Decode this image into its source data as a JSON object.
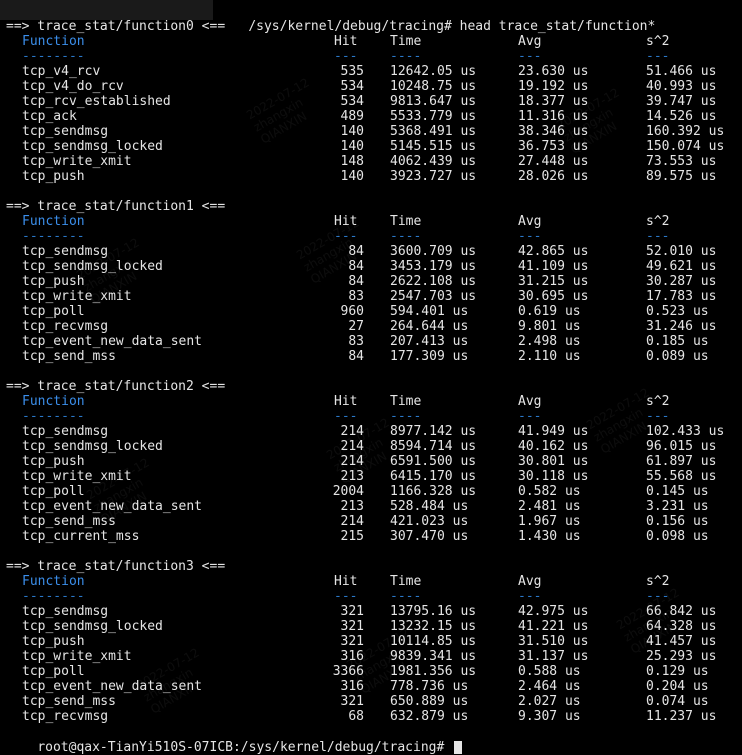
{
  "command": {
    "path_and_cmd": "/sys/kernel/debug/tracing# head trace_stat/function*"
  },
  "columns": {
    "function": "Function",
    "hit": "Hit",
    "time": "Time",
    "avg": "Avg",
    "s2": "s^2",
    "sep_function": "--------",
    "sep_short": "---",
    "sep_time": "----"
  },
  "sections": [
    {
      "header": "==> trace_stat/function0 <==",
      "rows": [
        {
          "name": "tcp_v4_rcv",
          "hit": "535",
          "time": "12642.05 us",
          "avg": "23.630 us",
          "s2": "51.466 us"
        },
        {
          "name": "tcp_v4_do_rcv",
          "hit": "534",
          "time": "10248.75 us",
          "avg": "19.192 us",
          "s2": "40.993 us"
        },
        {
          "name": "tcp_rcv_established",
          "hit": "534",
          "time": "9813.647 us",
          "avg": "18.377 us",
          "s2": "39.747 us"
        },
        {
          "name": "tcp_ack",
          "hit": "489",
          "time": "5533.779 us",
          "avg": "11.316 us",
          "s2": "14.526 us"
        },
        {
          "name": "tcp_sendmsg",
          "hit": "140",
          "time": "5368.491 us",
          "avg": "38.346 us",
          "s2": "160.392 us"
        },
        {
          "name": "tcp_sendmsg_locked",
          "hit": "140",
          "time": "5145.515 us",
          "avg": "36.753 us",
          "s2": "150.074 us"
        },
        {
          "name": "tcp_write_xmit",
          "hit": "148",
          "time": "4062.439 us",
          "avg": "27.448 us",
          "s2": "73.553 us"
        },
        {
          "name": "tcp_push",
          "hit": "140",
          "time": "3923.727 us",
          "avg": "28.026 us",
          "s2": "89.575 us"
        }
      ]
    },
    {
      "header": "==> trace_stat/function1 <==",
      "rows": [
        {
          "name": "tcp_sendmsg",
          "hit": "84",
          "time": "3600.709 us",
          "avg": "42.865 us",
          "s2": "52.010 us"
        },
        {
          "name": "tcp_sendmsg_locked",
          "hit": "84",
          "time": "3453.179 us",
          "avg": "41.109 us",
          "s2": "49.621 us"
        },
        {
          "name": "tcp_push",
          "hit": "84",
          "time": "2622.108 us",
          "avg": "31.215 us",
          "s2": "30.287 us"
        },
        {
          "name": "tcp_write_xmit",
          "hit": "83",
          "time": "2547.703 us",
          "avg": "30.695 us",
          "s2": "17.783 us"
        },
        {
          "name": "tcp_poll",
          "hit": "960",
          "time": "594.401 us",
          "avg": "0.619 us",
          "s2": "0.523 us"
        },
        {
          "name": "tcp_recvmsg",
          "hit": "27",
          "time": "264.644 us",
          "avg": "9.801 us",
          "s2": "31.246 us"
        },
        {
          "name": "tcp_event_new_data_sent",
          "hit": "83",
          "time": "207.413 us",
          "avg": "2.498 us",
          "s2": "0.185 us"
        },
        {
          "name": "tcp_send_mss",
          "hit": "84",
          "time": "177.309 us",
          "avg": "2.110 us",
          "s2": "0.089 us"
        }
      ]
    },
    {
      "header": "==> trace_stat/function2 <==",
      "rows": [
        {
          "name": "tcp_sendmsg",
          "hit": "214",
          "time": "8977.142 us",
          "avg": "41.949 us",
          "s2": "102.433 us"
        },
        {
          "name": "tcp_sendmsg_locked",
          "hit": "214",
          "time": "8594.714 us",
          "avg": "40.162 us",
          "s2": "96.015 us"
        },
        {
          "name": "tcp_push",
          "hit": "214",
          "time": "6591.500 us",
          "avg": "30.801 us",
          "s2": "61.897 us"
        },
        {
          "name": "tcp_write_xmit",
          "hit": "213",
          "time": "6415.170 us",
          "avg": "30.118 us",
          "s2": "55.568 us"
        },
        {
          "name": "tcp_poll",
          "hit": "2004",
          "time": "1166.328 us",
          "avg": "0.582 us",
          "s2": "0.145 us"
        },
        {
          "name": "tcp_event_new_data_sent",
          "hit": "213",
          "time": "528.484 us",
          "avg": "2.481 us",
          "s2": "3.231 us"
        },
        {
          "name": "tcp_send_mss",
          "hit": "214",
          "time": "421.023 us",
          "avg": "1.967 us",
          "s2": "0.156 us"
        },
        {
          "name": "tcp_current_mss",
          "hit": "215",
          "time": "307.470 us",
          "avg": "1.430 us",
          "s2": "0.098 us"
        }
      ]
    },
    {
      "header": "==> trace_stat/function3 <==",
      "rows": [
        {
          "name": "tcp_sendmsg",
          "hit": "321",
          "time": "13795.16 us",
          "avg": "42.975 us",
          "s2": "66.842 us"
        },
        {
          "name": "tcp_sendmsg_locked",
          "hit": "321",
          "time": "13232.15 us",
          "avg": "41.221 us",
          "s2": "64.328 us"
        },
        {
          "name": "tcp_push",
          "hit": "321",
          "time": "10114.85 us",
          "avg": "31.510 us",
          "s2": "41.457 us"
        },
        {
          "name": "tcp_write_xmit",
          "hit": "316",
          "time": "9839.341 us",
          "avg": "31.137 us",
          "s2": "25.293 us"
        },
        {
          "name": "tcp_poll",
          "hit": "3366",
          "time": "1981.356 us",
          "avg": "0.588 us",
          "s2": "0.129 us"
        },
        {
          "name": "tcp_event_new_data_sent",
          "hit": "316",
          "time": "778.736 us",
          "avg": "2.464 us",
          "s2": "0.204 us"
        },
        {
          "name": "tcp_send_mss",
          "hit": "321",
          "time": "650.889 us",
          "avg": "2.027 us",
          "s2": "0.074 us"
        },
        {
          "name": "tcp_recvmsg",
          "hit": "68",
          "time": "632.879 us",
          "avg": "9.307 us",
          "s2": "11.237 us"
        }
      ]
    }
  ],
  "prompt": {
    "text": "root@qax-TianYi510S-07ICB:/sys/kernel/debug/tracing# "
  },
  "watermark": {
    "lines": [
      "2022-07-12",
      "zhangxin",
      "QIANXIN"
    ]
  },
  "colors": {
    "background": "#000000",
    "foreground": "#e5e5e5",
    "column_header_accent": "#3b8eea",
    "separator": "#2a78c8"
  }
}
